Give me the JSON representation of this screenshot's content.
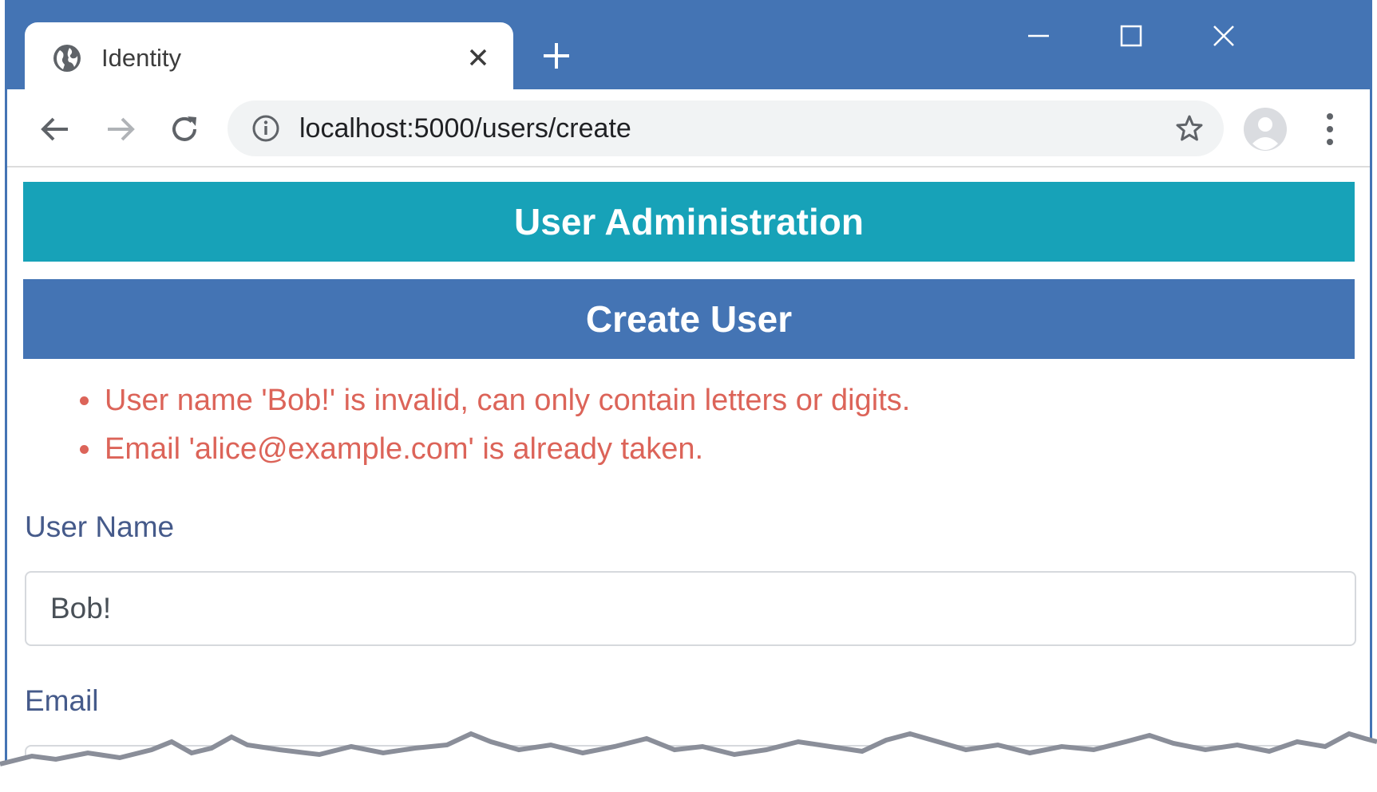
{
  "browser": {
    "tab": {
      "title": "Identity",
      "icon": "globe-icon"
    },
    "address": {
      "url": "localhost:5000/users/create"
    },
    "colors": {
      "titlebar": "#4474b4",
      "omnibox": "#f1f3f4"
    }
  },
  "page": {
    "header_title": "User Administration",
    "section_title": "Create User",
    "errors": [
      "User name 'Bob!' is invalid, can only contain letters or digits.",
      "Email 'alice@example.com' is already taken."
    ],
    "form": {
      "username_label": "User Name",
      "username_value": "Bob!",
      "email_label": "Email",
      "email_value": ""
    },
    "colors": {
      "header_bg": "#17a2b8",
      "section_bg": "#4474b4",
      "error_text": "#dc6459",
      "label_text": "#455a8a"
    }
  }
}
